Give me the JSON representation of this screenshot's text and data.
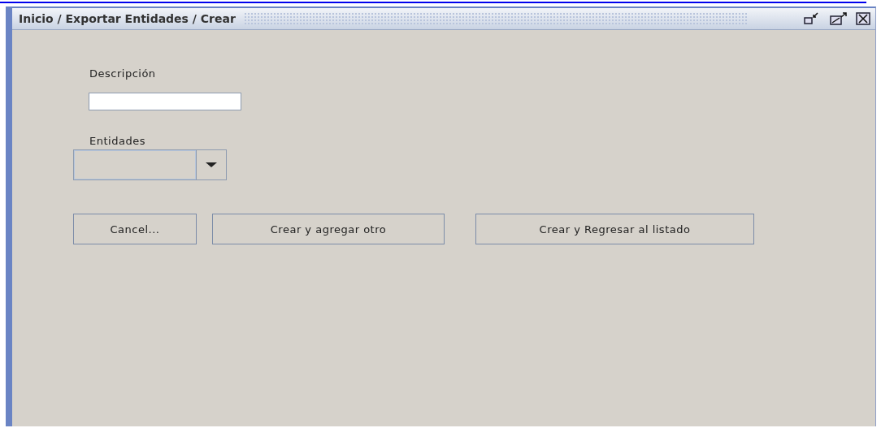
{
  "window": {
    "title": "Inicio / Exportar Entidades / Crear"
  },
  "form": {
    "description_label": "Descripción",
    "entities_label": "Entidades"
  },
  "buttons": [
    "Cancel...",
    "Crear y agregar otro",
    "Crear y Regresar al listado"
  ]
}
